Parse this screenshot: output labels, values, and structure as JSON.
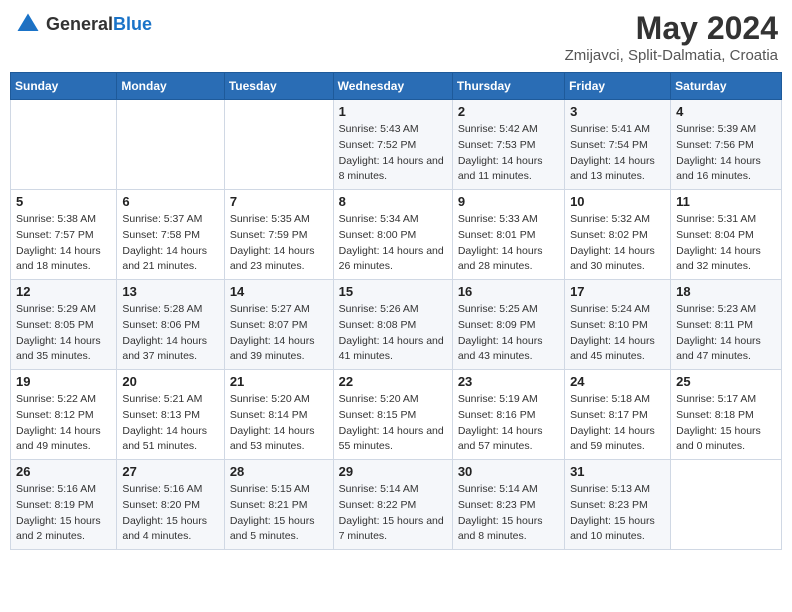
{
  "header": {
    "logo_general": "General",
    "logo_blue": "Blue",
    "title": "May 2024",
    "subtitle": "Zmijavci, Split-Dalmatia, Croatia"
  },
  "weekdays": [
    "Sunday",
    "Monday",
    "Tuesday",
    "Wednesday",
    "Thursday",
    "Friday",
    "Saturday"
  ],
  "weeks": [
    [
      {
        "day": "",
        "sunrise": "",
        "sunset": "",
        "daylight": ""
      },
      {
        "day": "",
        "sunrise": "",
        "sunset": "",
        "daylight": ""
      },
      {
        "day": "",
        "sunrise": "",
        "sunset": "",
        "daylight": ""
      },
      {
        "day": "1",
        "sunrise": "Sunrise: 5:43 AM",
        "sunset": "Sunset: 7:52 PM",
        "daylight": "Daylight: 14 hours and 8 minutes."
      },
      {
        "day": "2",
        "sunrise": "Sunrise: 5:42 AM",
        "sunset": "Sunset: 7:53 PM",
        "daylight": "Daylight: 14 hours and 11 minutes."
      },
      {
        "day": "3",
        "sunrise": "Sunrise: 5:41 AM",
        "sunset": "Sunset: 7:54 PM",
        "daylight": "Daylight: 14 hours and 13 minutes."
      },
      {
        "day": "4",
        "sunrise": "Sunrise: 5:39 AM",
        "sunset": "Sunset: 7:56 PM",
        "daylight": "Daylight: 14 hours and 16 minutes."
      }
    ],
    [
      {
        "day": "5",
        "sunrise": "Sunrise: 5:38 AM",
        "sunset": "Sunset: 7:57 PM",
        "daylight": "Daylight: 14 hours and 18 minutes."
      },
      {
        "day": "6",
        "sunrise": "Sunrise: 5:37 AM",
        "sunset": "Sunset: 7:58 PM",
        "daylight": "Daylight: 14 hours and 21 minutes."
      },
      {
        "day": "7",
        "sunrise": "Sunrise: 5:35 AM",
        "sunset": "Sunset: 7:59 PM",
        "daylight": "Daylight: 14 hours and 23 minutes."
      },
      {
        "day": "8",
        "sunrise": "Sunrise: 5:34 AM",
        "sunset": "Sunset: 8:00 PM",
        "daylight": "Daylight: 14 hours and 26 minutes."
      },
      {
        "day": "9",
        "sunrise": "Sunrise: 5:33 AM",
        "sunset": "Sunset: 8:01 PM",
        "daylight": "Daylight: 14 hours and 28 minutes."
      },
      {
        "day": "10",
        "sunrise": "Sunrise: 5:32 AM",
        "sunset": "Sunset: 8:02 PM",
        "daylight": "Daylight: 14 hours and 30 minutes."
      },
      {
        "day": "11",
        "sunrise": "Sunrise: 5:31 AM",
        "sunset": "Sunset: 8:04 PM",
        "daylight": "Daylight: 14 hours and 32 minutes."
      }
    ],
    [
      {
        "day": "12",
        "sunrise": "Sunrise: 5:29 AM",
        "sunset": "Sunset: 8:05 PM",
        "daylight": "Daylight: 14 hours and 35 minutes."
      },
      {
        "day": "13",
        "sunrise": "Sunrise: 5:28 AM",
        "sunset": "Sunset: 8:06 PM",
        "daylight": "Daylight: 14 hours and 37 minutes."
      },
      {
        "day": "14",
        "sunrise": "Sunrise: 5:27 AM",
        "sunset": "Sunset: 8:07 PM",
        "daylight": "Daylight: 14 hours and 39 minutes."
      },
      {
        "day": "15",
        "sunrise": "Sunrise: 5:26 AM",
        "sunset": "Sunset: 8:08 PM",
        "daylight": "Daylight: 14 hours and 41 minutes."
      },
      {
        "day": "16",
        "sunrise": "Sunrise: 5:25 AM",
        "sunset": "Sunset: 8:09 PM",
        "daylight": "Daylight: 14 hours and 43 minutes."
      },
      {
        "day": "17",
        "sunrise": "Sunrise: 5:24 AM",
        "sunset": "Sunset: 8:10 PM",
        "daylight": "Daylight: 14 hours and 45 minutes."
      },
      {
        "day": "18",
        "sunrise": "Sunrise: 5:23 AM",
        "sunset": "Sunset: 8:11 PM",
        "daylight": "Daylight: 14 hours and 47 minutes."
      }
    ],
    [
      {
        "day": "19",
        "sunrise": "Sunrise: 5:22 AM",
        "sunset": "Sunset: 8:12 PM",
        "daylight": "Daylight: 14 hours and 49 minutes."
      },
      {
        "day": "20",
        "sunrise": "Sunrise: 5:21 AM",
        "sunset": "Sunset: 8:13 PM",
        "daylight": "Daylight: 14 hours and 51 minutes."
      },
      {
        "day": "21",
        "sunrise": "Sunrise: 5:20 AM",
        "sunset": "Sunset: 8:14 PM",
        "daylight": "Daylight: 14 hours and 53 minutes."
      },
      {
        "day": "22",
        "sunrise": "Sunrise: 5:20 AM",
        "sunset": "Sunset: 8:15 PM",
        "daylight": "Daylight: 14 hours and 55 minutes."
      },
      {
        "day": "23",
        "sunrise": "Sunrise: 5:19 AM",
        "sunset": "Sunset: 8:16 PM",
        "daylight": "Daylight: 14 hours and 57 minutes."
      },
      {
        "day": "24",
        "sunrise": "Sunrise: 5:18 AM",
        "sunset": "Sunset: 8:17 PM",
        "daylight": "Daylight: 14 hours and 59 minutes."
      },
      {
        "day": "25",
        "sunrise": "Sunrise: 5:17 AM",
        "sunset": "Sunset: 8:18 PM",
        "daylight": "Daylight: 15 hours and 0 minutes."
      }
    ],
    [
      {
        "day": "26",
        "sunrise": "Sunrise: 5:16 AM",
        "sunset": "Sunset: 8:19 PM",
        "daylight": "Daylight: 15 hours and 2 minutes."
      },
      {
        "day": "27",
        "sunrise": "Sunrise: 5:16 AM",
        "sunset": "Sunset: 8:20 PM",
        "daylight": "Daylight: 15 hours and 4 minutes."
      },
      {
        "day": "28",
        "sunrise": "Sunrise: 5:15 AM",
        "sunset": "Sunset: 8:21 PM",
        "daylight": "Daylight: 15 hours and 5 minutes."
      },
      {
        "day": "29",
        "sunrise": "Sunrise: 5:14 AM",
        "sunset": "Sunset: 8:22 PM",
        "daylight": "Daylight: 15 hours and 7 minutes."
      },
      {
        "day": "30",
        "sunrise": "Sunrise: 5:14 AM",
        "sunset": "Sunset: 8:23 PM",
        "daylight": "Daylight: 15 hours and 8 minutes."
      },
      {
        "day": "31",
        "sunrise": "Sunrise: 5:13 AM",
        "sunset": "Sunset: 8:23 PM",
        "daylight": "Daylight: 15 hours and 10 minutes."
      },
      {
        "day": "",
        "sunrise": "",
        "sunset": "",
        "daylight": ""
      }
    ]
  ]
}
